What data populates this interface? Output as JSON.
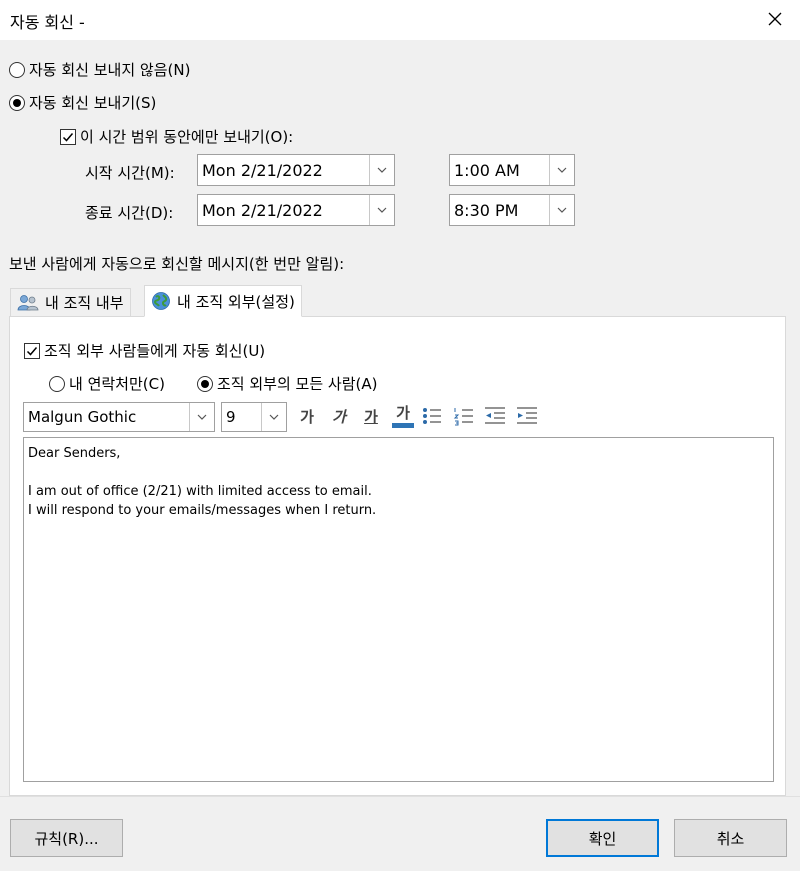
{
  "window": {
    "title": "자동 회신 -"
  },
  "options": {
    "no_reply_label": "자동 회신 보내지 않음(N)",
    "send_reply_label": "자동 회신 보내기(S)",
    "time_range_label": "이 시간 범위 동안에만 보내기(O):",
    "start_label": "시작 시간(M):",
    "end_label": "종료 시간(D):",
    "start_date": "Mon 2/21/2022",
    "start_time": "1:00 AM",
    "end_date": "Mon 2/21/2022",
    "end_time": "8:30 PM"
  },
  "message_section_label": "보낸 사람에게 자동으로 회신할 메시지(한 번만 알림):",
  "tabs": [
    {
      "label": "내 조직 내부",
      "icon": "people-icon",
      "active": false
    },
    {
      "label": "내 조직 외부(설정)",
      "icon": "globe-icon",
      "active": true
    }
  ],
  "outside": {
    "auto_reply_label": "조직 외부 사람들에게 자동 회신(U)",
    "contacts_only_label": "내 연락처만(C)",
    "everyone_label": "조직 외부의 모든 사람(A)"
  },
  "toolbar": {
    "font_name": "Malgun Gothic",
    "font_size": "9",
    "bold_glyph": "가",
    "italic_glyph": "가",
    "underline_glyph": "가",
    "color_glyph": "가",
    "font_color": "#2e74b5"
  },
  "message_lines": [
    "Dear Senders,",
    "",
    "I am out of office (2/21) with limited access to email.",
    "I will respond to your emails/messages when I return."
  ],
  "buttons": {
    "rules": "규칙(R)...",
    "ok": "확인",
    "cancel": "취소"
  },
  "colors": {
    "accent": "#0078d7",
    "dialog_bg": "#f0f0f0"
  }
}
